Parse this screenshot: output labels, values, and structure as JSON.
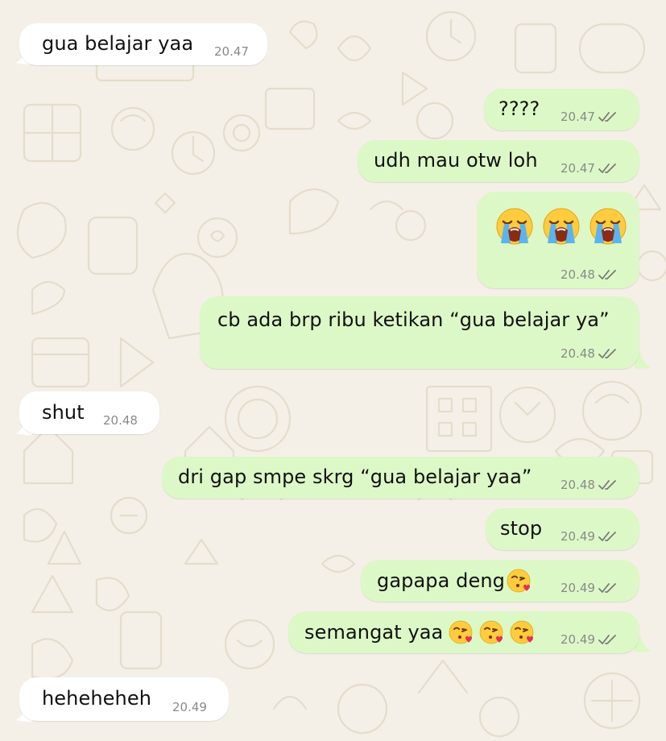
{
  "theme": {
    "incoming_bg": "#ffffff",
    "outgoing_bg": "#dcf8c6",
    "wallpaper": "#f4f0e8",
    "meta_color": "#8a8a8a"
  },
  "messages": [
    {
      "id": 1,
      "dir": "in",
      "text": "gua belajar yaa",
      "time": "20.47"
    },
    {
      "id": 2,
      "dir": "out",
      "text": "????",
      "time": "20.47",
      "status": "double-check-read"
    },
    {
      "id": 3,
      "dir": "out",
      "text": "udh mau otw loh",
      "time": "20.47",
      "status": "double-check-read"
    },
    {
      "id": 4,
      "dir": "out",
      "text": "",
      "emoji": [
        "loudly-crying-face",
        "loudly-crying-face",
        "loudly-crying-face"
      ],
      "time": "20.48",
      "status": "double-check-read"
    },
    {
      "id": 5,
      "dir": "out",
      "text": "cb ada brp ribu ketikan “gua belajar ya”",
      "time": "20.48",
      "status": "double-check-read"
    },
    {
      "id": 6,
      "dir": "in",
      "text": "shut",
      "time": "20.48"
    },
    {
      "id": 7,
      "dir": "out",
      "text": "dri gap smpe skrg “gua belajar yaa”",
      "time": "20.48",
      "status": "double-check-read"
    },
    {
      "id": 8,
      "dir": "out",
      "text": "stop",
      "time": "20.49",
      "status": "double-check-read"
    },
    {
      "id": 9,
      "dir": "out",
      "text": "gapapa deng",
      "emoji": [
        "face-blowing-a-kiss"
      ],
      "time": "20.49",
      "status": "double-check-read"
    },
    {
      "id": 10,
      "dir": "out",
      "text": "semangat yaa",
      "emoji": [
        "face-blowing-a-kiss",
        "face-blowing-a-kiss",
        "face-blowing-a-kiss"
      ],
      "time": "20.49",
      "status": "double-check-read"
    },
    {
      "id": 11,
      "dir": "in",
      "text": "heheheheh",
      "time": "20.49"
    }
  ]
}
